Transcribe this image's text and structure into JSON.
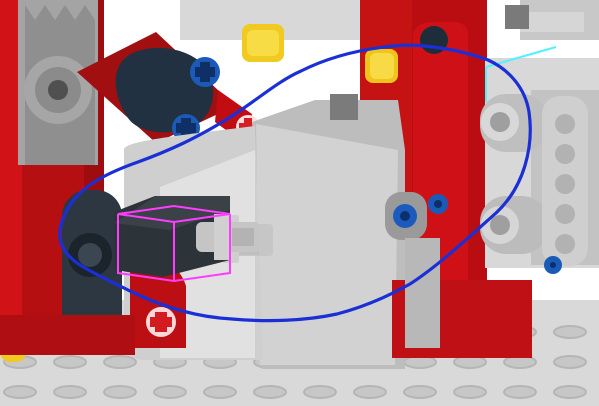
{
  "app": {
    "mode": "3d-viewport",
    "selection": "axle-connector-brick"
  },
  "scene": {
    "background": "#ffffff",
    "baseplate": "#d7d7d7",
    "studs": "#bdbdbd",
    "red": "#c40b10",
    "dark_red": "#7f0a0b",
    "yellow": "#f2cf24",
    "blue_axle": "#1d5fb8",
    "dark_bluegray": "#25313b",
    "light_gray": "#d4d4d4",
    "mid_gray": "#a9a9a9",
    "selection_magenta": "#ff3cff",
    "selection_cyan": "#51f2ff",
    "annotation_blue": "#1a2fd6"
  },
  "tools": {
    "annotation_stroke": "freehand-loop",
    "selection_box": "magenta-bounding-box",
    "axis_hint": "cyan-corner"
  }
}
